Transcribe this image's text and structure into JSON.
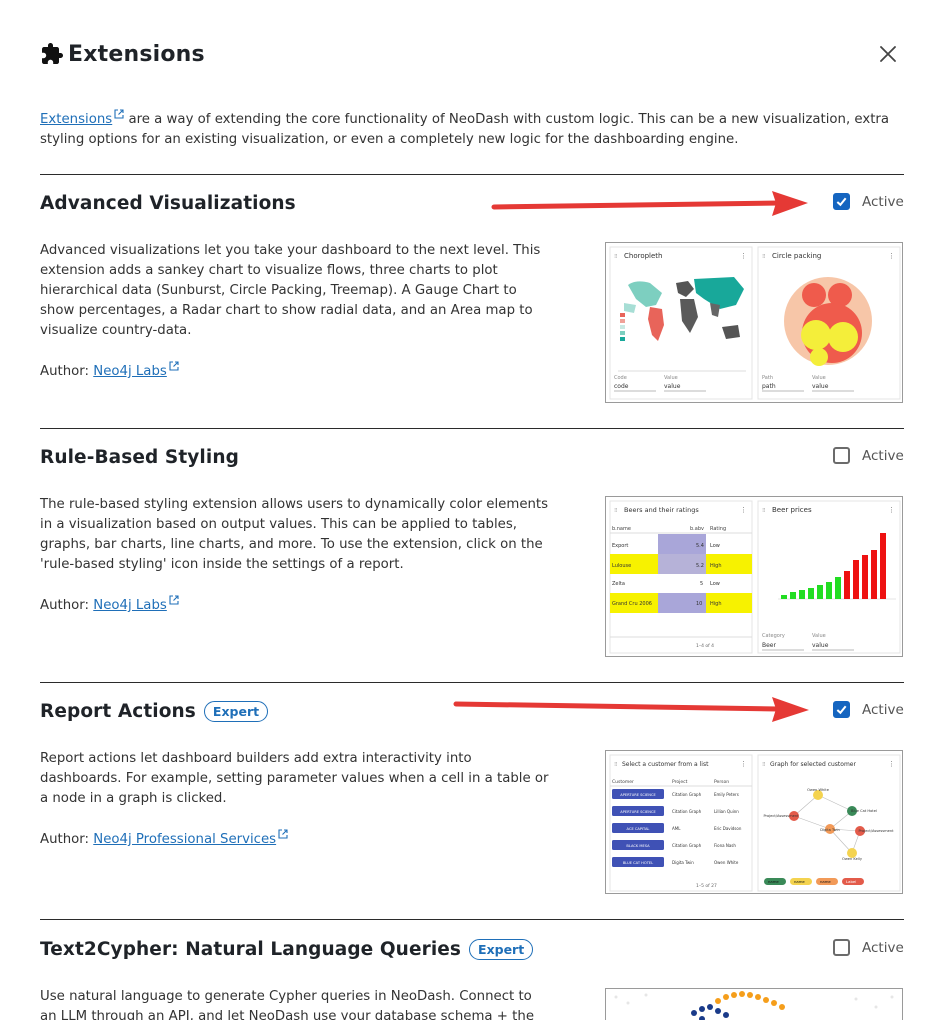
{
  "dialog": {
    "title": "Extensions"
  },
  "intro": {
    "link_text": "Extensions",
    "text": " are a way of extending the core functionality of NeoDash with custom logic. This can be a new visualization, extra styling options for an existing visualization, or even a completely new logic for the dashboarding engine."
  },
  "extensions": [
    {
      "title": "Advanced Visualizations",
      "badge": "",
      "active_label": "Active",
      "active": true,
      "description": "Advanced visualizations let you take your dashboard to the next level. This extension adds a sankey chart to visualize flows, three charts to plot hierarchical data (Sunburst, Circle Packing, Treemap). A Gauge Chart to show percentages, a Radar chart to show radial data, and an Area map to visualize country-data.",
      "author_prefix": "Author: ",
      "author": "Neo4j Labs",
      "preview": {
        "left_title": "Choropleth",
        "right_title": "Circle packing",
        "left_field1_label": "Code",
        "left_field1_value": "code",
        "left_field2_label": "Value",
        "left_field2_value": "value",
        "right_field1_label": "Path",
        "right_field1_value": "path",
        "right_field2_label": "Value",
        "right_field2_value": "value"
      }
    },
    {
      "title": "Rule-Based Styling",
      "badge": "",
      "active_label": "Active",
      "active": false,
      "description": "The rule-based styling extension allows users to dynamically color elements in a visualization based on output values. This can be applied to tables, graphs, bar charts, line charts, and more. To use the extension, click on the 'rule-based styling' icon inside the settings of a report.",
      "author_prefix": "Author: ",
      "author": "Neo4j Labs",
      "preview": {
        "left_title": "Beers and their ratings",
        "right_title": "Beer prices",
        "col1": "b.name",
        "col2": "b.abv",
        "col3": "Rating",
        "rows": [
          {
            "name": "Export",
            "abv": "5.4",
            "rating": "Low"
          },
          {
            "name": "Lulouse",
            "abv": "5.2",
            "rating": "High"
          },
          {
            "name": "Zelta",
            "abv": "5",
            "rating": "Low"
          },
          {
            "name": "Grand Cru 2006",
            "abv": "10",
            "rating": "High"
          }
        ],
        "pagination": "1–4 of 4",
        "right_field1_label": "Category",
        "right_field1_value": "Beer",
        "right_field2_label": "Value",
        "right_field2_value": "value"
      }
    },
    {
      "title": "Report Actions",
      "badge": "Expert",
      "active_label": "Active",
      "active": true,
      "description": "Report actions let dashboard builders add extra interactivity into dashboards. For example, setting parameter values when a cell in a table or a node in a graph is clicked.",
      "author_prefix": "Author: ",
      "author": "Neo4j Professional Services",
      "preview": {
        "left_title": "Select a customer from a list",
        "right_title": "Graph for selected customer",
        "col1": "Customer",
        "col2": "Project",
        "col3": "Person",
        "rows": [
          {
            "customer": "APERTURE SCIENCE",
            "project": "Citation Graph",
            "person": "Emily Peters"
          },
          {
            "customer": "APERTURE SCIENCE",
            "project": "Citation Graph",
            "person": "Lillian Quinn"
          },
          {
            "customer": "ACE CAPITAL",
            "project": "AML",
            "person": "Eric Davidson"
          },
          {
            "customer": "BLACK MESA",
            "project": "Citation Graph",
            "person": "Fiona Nash"
          },
          {
            "customer": "BLUE CAT HOTEL",
            "project": "Digita Twin",
            "person": "Owen White"
          }
        ],
        "pagination": "1–5 of 27",
        "node_labels": [
          "Owen White",
          "Project/Assessment",
          "Blue Cat Hotel",
          "Digita Twin",
          "Project/Assessment",
          "Owen Kelly"
        ],
        "legend": [
          "name",
          "name",
          "name",
          "Label"
        ]
      }
    },
    {
      "title": "Text2Cypher: Natural Language Queries",
      "badge": "Expert",
      "active_label": "Active",
      "active": false,
      "description": "Use natural language to generate Cypher queries in NeoDash. Connect to an LLM through an API, and let NeoDash use your database schema + the report"
    }
  ],
  "colors": {
    "accent": "#1565c0",
    "link": "#1f6fb8",
    "arrow": "#e53935"
  }
}
